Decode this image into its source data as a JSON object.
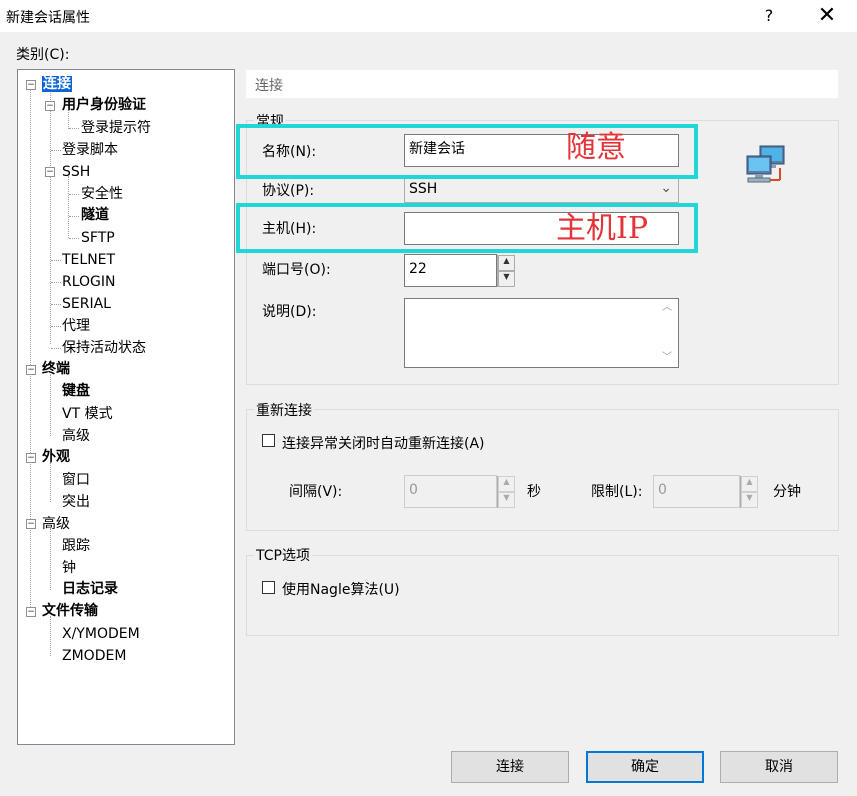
{
  "window": {
    "title": "新建会话属性",
    "help_label": "?",
    "close_label": "✕"
  },
  "category_label": "类别(C):",
  "tree": {
    "items": [
      {
        "label": "连接",
        "bold": true,
        "selected": true,
        "expanded": true
      },
      {
        "label": "用户身份验证",
        "bold": true,
        "expanded": true
      },
      {
        "label": "登录提示符"
      },
      {
        "label": "登录脚本"
      },
      {
        "label": "SSH",
        "expanded": true
      },
      {
        "label": "安全性"
      },
      {
        "label": "隧道",
        "bold": true
      },
      {
        "label": "SFTP"
      },
      {
        "label": "TELNET"
      },
      {
        "label": "RLOGIN"
      },
      {
        "label": "SERIAL"
      },
      {
        "label": "代理"
      },
      {
        "label": "保持活动状态"
      },
      {
        "label": "终端",
        "bold": true,
        "expanded": true
      },
      {
        "label": "键盘",
        "bold": true
      },
      {
        "label": "VT 模式"
      },
      {
        "label": "高级"
      },
      {
        "label": "外观",
        "bold": true,
        "expanded": true
      },
      {
        "label": "窗口"
      },
      {
        "label": "突出"
      },
      {
        "label": "高级",
        "expanded": true
      },
      {
        "label": "跟踪"
      },
      {
        "label": "钟"
      },
      {
        "label": "日志记录",
        "bold": true
      },
      {
        "label": "文件传输",
        "bold": true,
        "expanded": true
      },
      {
        "label": "X/YMODEM"
      },
      {
        "label": "ZMODEM"
      }
    ]
  },
  "panel": {
    "header": "连接",
    "general": {
      "title": "常规",
      "name_label": "名称(N):",
      "name_value": "新建会话",
      "protocol_label": "协议(P):",
      "protocol_value": "SSH",
      "host_label": "主机(H):",
      "host_value": "",
      "port_label": "端口号(O):",
      "port_value": "22",
      "desc_label": "说明(D):",
      "desc_value": ""
    },
    "reconnect": {
      "title": "重新连接",
      "auto_label": "连接异常关闭时自动重新连接(A)",
      "auto_checked": false,
      "interval_label": "间隔(V):",
      "interval_value": "0",
      "interval_unit": "秒",
      "limit_label": "限制(L):",
      "limit_value": "0",
      "limit_unit": "分钟"
    },
    "tcp": {
      "title": "TCP选项",
      "nagle_label": "使用Nagle算法(U)",
      "nagle_checked": false
    }
  },
  "annotations": {
    "name_note": "随意",
    "host_note": "主机IP",
    "highlight_color": "#20d6d6",
    "note_color": "#e5333a"
  },
  "buttons": {
    "connect": "连接",
    "ok": "确定",
    "cancel": "取消"
  },
  "icons": {
    "network": "network-computers-icon"
  }
}
